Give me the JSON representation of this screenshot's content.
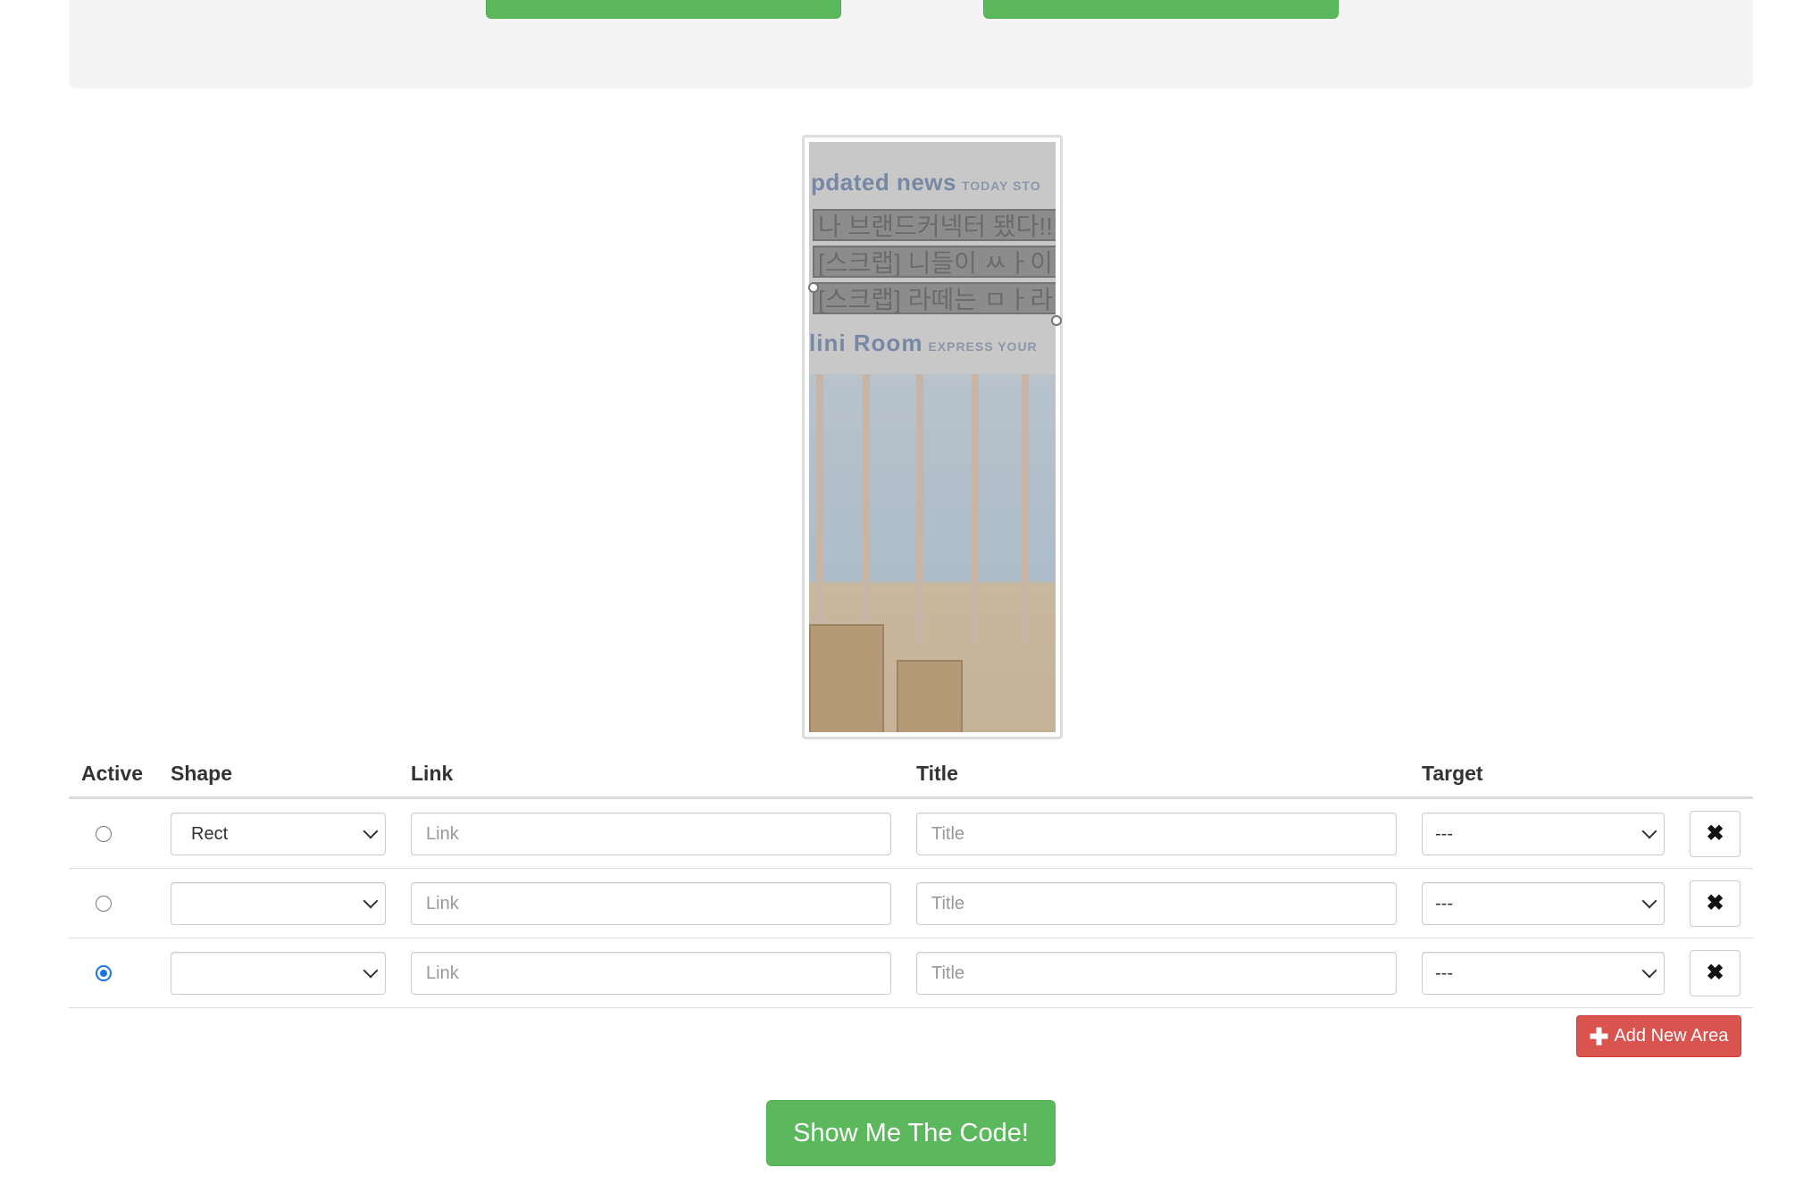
{
  "preview": {
    "news_heading": "pdated news",
    "news_subheading": "TODAY STO",
    "news_rows": [
      "나 브랜드커넥터 됐다!!!",
      "[스크랩] 니들이 ㅆㅏ이",
      "[스크랩] 라떼는 ㅁㅏ라"
    ],
    "room_heading": "lini Room",
    "room_subheading": "EXPRESS YOUR"
  },
  "table": {
    "headers": {
      "active": "Active",
      "shape": "Shape",
      "link": "Link",
      "title": "Title",
      "target": "Target"
    },
    "rows": [
      {
        "active": false,
        "shape": "Rect",
        "link_placeholder": "Link",
        "title_placeholder": "Title",
        "target": "---"
      },
      {
        "active": false,
        "shape": "",
        "link_placeholder": "Link",
        "title_placeholder": "Title",
        "target": "---"
      },
      {
        "active": true,
        "shape": "",
        "link_placeholder": "Link",
        "title_placeholder": "Title",
        "target": "---"
      }
    ]
  },
  "buttons": {
    "add_area": "Add New Area",
    "show_code": "Show Me The Code!"
  },
  "icons": {
    "delete": "close-icon",
    "add": "plus-icon"
  },
  "colors": {
    "success": "#5cb85c",
    "danger": "#d9534f",
    "radio_checked": "#1a73e8"
  }
}
